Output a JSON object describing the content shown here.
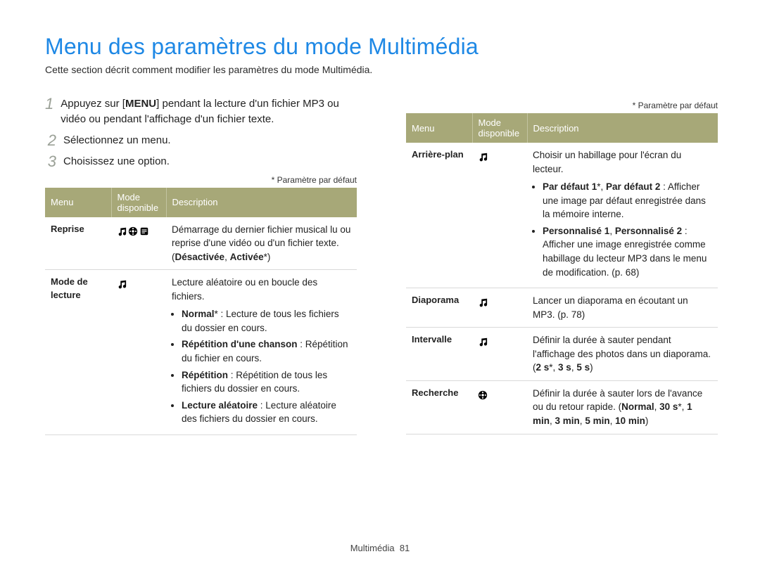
{
  "title": "Menu des paramètres du mode Multimédia",
  "intro": "Cette section décrit comment modifier les paramètres du mode Multimédia.",
  "steps": [
    {
      "num": "1",
      "text_pre": "Appuyez sur [",
      "key": "MENU",
      "text_post": "] pendant la lecture d'un fichier MP3 ou vidéo ou pendant l'affichage d'un fichier texte."
    },
    {
      "num": "2",
      "text_pre": "Sélectionnez un menu.",
      "key": "",
      "text_post": ""
    },
    {
      "num": "3",
      "text_pre": "Choisissez une option.",
      "key": "",
      "text_post": ""
    }
  ],
  "footnote": "* Paramètre par défaut",
  "headers": {
    "menu": "Menu",
    "mode": "Mode disponible",
    "desc": "Description"
  },
  "icons": {
    "music": "♫",
    "video": "🎞",
    "text": "▤"
  },
  "left_rows": [
    {
      "menu": "Reprise",
      "modes": [
        "music",
        "video",
        "text"
      ],
      "desc_html": "Démarrage du dernier fichier musical lu ou reprise d'une vidéo ou d'un fichier texte. (<span class='b'>Désactivée</span>, <span class='b'>Activée</span>*)"
    },
    {
      "menu": "Mode de lecture",
      "modes": [
        "music"
      ],
      "desc_html": "Lecture aléatoire ou en boucle des fichiers.<ul><li><span class='b'>Normal</span>* : Lecture de tous les fichiers du dossier en cours.</li><li><span class='b'>Répétition d'une chanson</span> : Répétition du fichier en cours.</li><li><span class='b'>Répétition</span> : Répétition de tous les fichiers du dossier en cours.</li><li><span class='b'>Lecture aléatoire</span> : Lecture aléatoire des fichiers du dossier en cours.</li></ul>"
    }
  ],
  "right_rows": [
    {
      "menu": "Arrière-plan",
      "modes": [
        "music"
      ],
      "desc_html": "Choisir un habillage pour l'écran du lecteur.<ul><li><span class='b'>Par défaut 1</span>*, <span class='b'>Par défaut 2</span> : Afficher une image par défaut enregistrée dans la mémoire interne.</li><li><span class='b'>Personnalisé 1</span>, <span class='b'>Personnalisé 2</span> : Afficher une image enregistrée comme habillage du lecteur MP3 dans le menu de modification. (p. 68)</li></ul>"
    },
    {
      "menu": "Diaporama",
      "modes": [
        "music"
      ],
      "desc_html": "Lancer un diaporama en écoutant un MP3. (p. 78)"
    },
    {
      "menu": "Intervalle",
      "modes": [
        "music"
      ],
      "desc_html": "Définir la durée à sauter pendant l'affichage des photos dans un diaporama. (<span class='b'>2 s</span>*, <span class='b'>3 s</span>, <span class='b'>5 s</span>)"
    },
    {
      "menu": "Recherche",
      "modes": [
        "video"
      ],
      "desc_html": "Définir la durée à sauter lors de l'avance ou du retour rapide. (<span class='b'>Normal</span>, <span class='b'>30 s</span>*, <span class='b'>1 min</span>, <span class='b'>3 min</span>, <span class='b'>5 min</span>, <span class='b'>10 min</span>)"
    }
  ],
  "footer": {
    "section": "Multimédia",
    "page": "81"
  }
}
